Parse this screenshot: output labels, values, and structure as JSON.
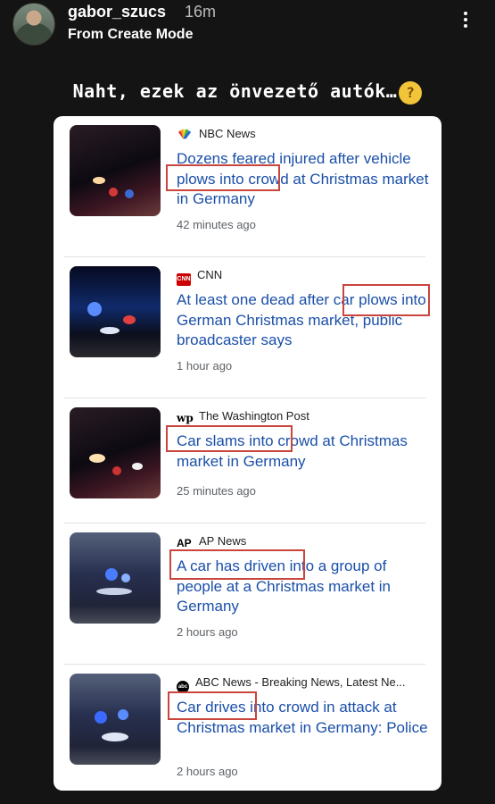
{
  "story": {
    "username": "gabor_szucs",
    "time": "16m",
    "subtitle": "From Create Mode",
    "caption": "Naht, ezek az önvezető autók…"
  },
  "emoji_icon": "thinking-face-icon",
  "articles": [
    {
      "source": "NBC News",
      "source_icon": "nbc-peacock-icon",
      "headline": "Dozens feared injured after vehicle plows into crowd at Christmas market in Germany",
      "time": "42 minutes ago",
      "highlighted_phrase": "vehicle plows"
    },
    {
      "source": "CNN",
      "source_icon": "cnn-logo-icon",
      "headline": "At least one dead after car plows into German Christmas market, public broadcaster says",
      "time": "1 hour ago",
      "highlighted_phrase": "car plows"
    },
    {
      "source": "The Washington Post",
      "source_icon": "wp-logo-icon",
      "headline": "Car slams into crowd at Christmas market in Germany",
      "time": "25 minutes ago",
      "highlighted_phrase": "Car slams into c"
    },
    {
      "source": "AP News",
      "source_icon": "ap-logo-icon",
      "headline": "A car has driven into a group of people at a Christmas market in Germany",
      "time": "2 hours ago",
      "highlighted_phrase": "A car has driven"
    },
    {
      "source": "ABC News - Breaking News, Latest Ne...",
      "source_icon": "abc-logo-icon",
      "headline": "Car drives into crowd in attack at Christmas market in Germany: Police",
      "time": "2 hours ago",
      "highlighted_phrase": "Car drives"
    }
  ],
  "colors": {
    "background": "#141414",
    "headline_link": "#1a4fa8",
    "highlight_box": "#c9453d"
  }
}
